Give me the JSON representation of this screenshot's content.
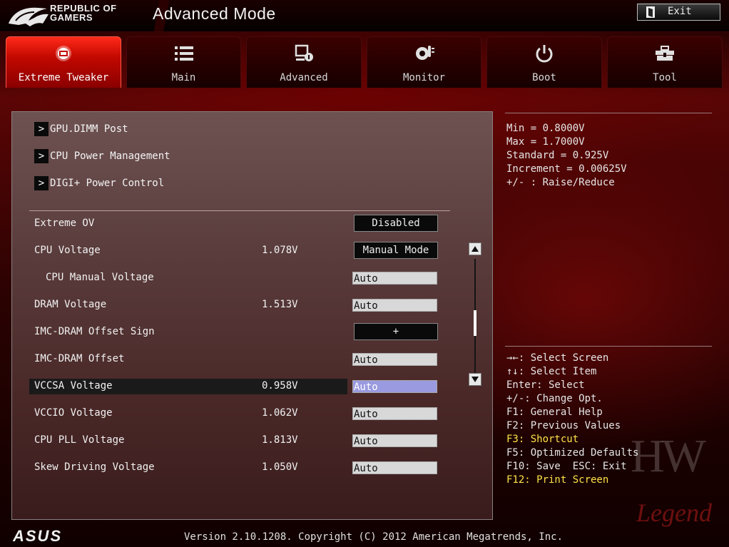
{
  "header": {
    "brand_line1": "REPUBLIC OF",
    "brand_line2": "GAMERS",
    "mode_title": "Advanced Mode",
    "exit_label": "Exit"
  },
  "tabs": [
    {
      "label": "Extreme Tweaker",
      "icon": "tweaker-icon",
      "active": true
    },
    {
      "label": "Main",
      "icon": "list-icon",
      "active": false
    },
    {
      "label": "Advanced",
      "icon": "advanced-icon",
      "active": false
    },
    {
      "label": "Monitor",
      "icon": "monitor-icon",
      "active": false
    },
    {
      "label": "Boot",
      "icon": "power-icon",
      "active": false
    },
    {
      "label": "Tool",
      "icon": "tool-icon",
      "active": false
    }
  ],
  "submenus": [
    {
      "label": "GPU.DIMM Post"
    },
    {
      "label": "CPU Power Management"
    },
    {
      "label": "DIGI+ Power Control"
    }
  ],
  "settings": [
    {
      "name": "Extreme OV",
      "value": "",
      "control": "Disabled"
    },
    {
      "name": "CPU Voltage",
      "value": "1.078V",
      "control": "Manual Mode"
    },
    {
      "name": "CPU Manual Voltage",
      "value": "",
      "control": "Auto"
    },
    {
      "name": "DRAM Voltage",
      "value": "1.513V",
      "control": "Auto"
    },
    {
      "name": "IMC-DRAM Offset Sign",
      "value": "",
      "control": "+"
    },
    {
      "name": "IMC-DRAM Offset",
      "value": "",
      "control": "Auto"
    },
    {
      "name": "VCCSA Voltage",
      "value": "0.958V",
      "control": "Auto"
    },
    {
      "name": "VCCIO Voltage",
      "value": "1.062V",
      "control": "Auto"
    },
    {
      "name": "CPU PLL Voltage",
      "value": "1.813V",
      "control": "Auto"
    },
    {
      "name": "Skew Driving Voltage",
      "value": "1.050V",
      "control": "Auto"
    }
  ],
  "info": [
    "Min = 0.8000V",
    "Max = 1.7000V",
    "Standard = 0.925V",
    "Increment = 0.00625V",
    "+/- : Raise/Reduce"
  ],
  "help": [
    "→←: Select Screen",
    "↑↓: Select Item",
    "Enter: Select",
    "+/-: Change Opt.",
    "F1: General Help",
    "F2: Previous Values",
    "F3: Shortcut",
    "F5: Optimized Defaults",
    "F10: Save  ESC: Exit",
    "F12: Print Screen"
  ],
  "watermark": {
    "line1": "HW",
    "line2": "Legend"
  },
  "footer": {
    "brand": "ASUS",
    "version": "Version 2.10.1208. Copyright (C) 2012 American Megatrends, Inc."
  },
  "colors": {
    "accent": "#c20800",
    "selected_field": "#9a9ae0",
    "highlight_text": "#ffe24a"
  }
}
